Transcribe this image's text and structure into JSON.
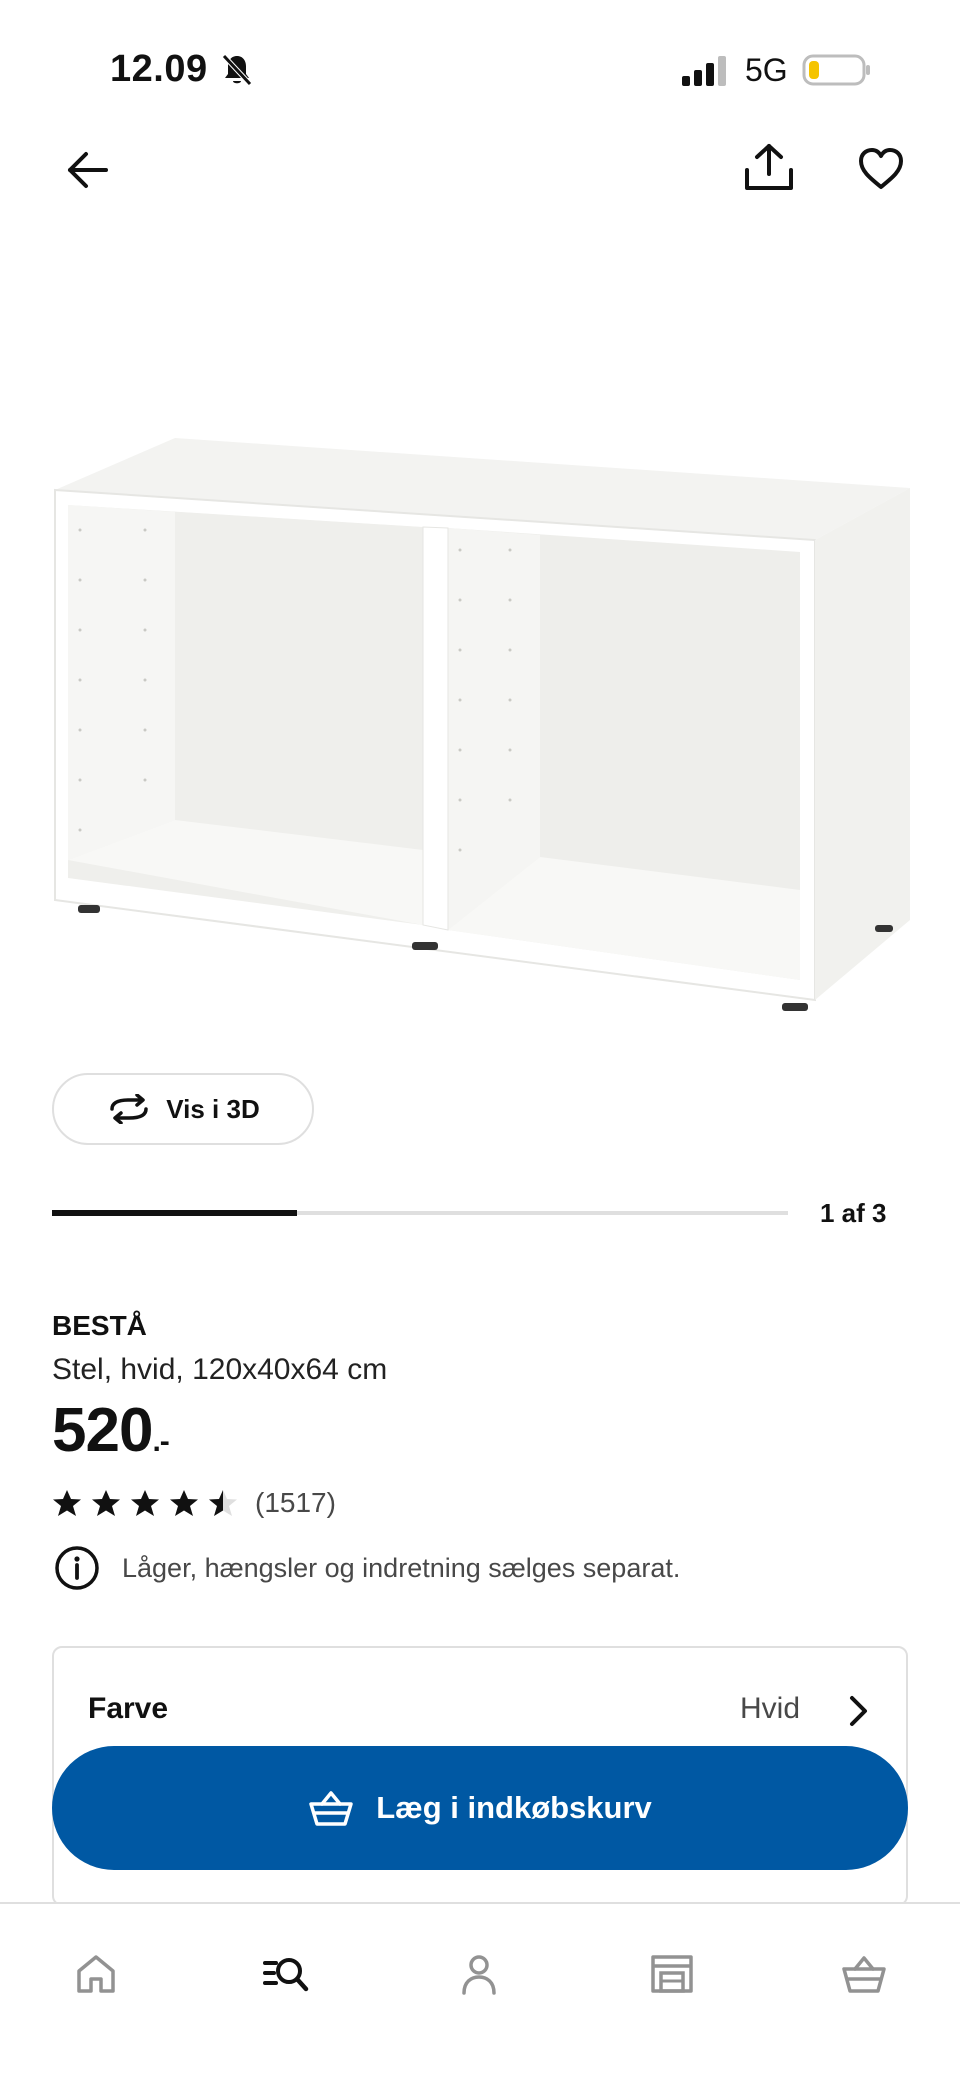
{
  "status_bar": {
    "time": "12.09",
    "network": "5G",
    "battery_color": "#f5c400"
  },
  "nav": {
    "back_icon": "arrow-left-icon",
    "share_icon": "share-icon",
    "favorite_icon": "heart-icon"
  },
  "gallery": {
    "view_3d_label": "Vis i 3D",
    "counter": "1 af 3",
    "current_image": 1,
    "total_images": 3
  },
  "product": {
    "name": "BESTÅ",
    "description": "Stel, hvid, 120x40x64 cm",
    "price": "520",
    "price_suffix": ".-",
    "rating": 4.5,
    "review_count": "(1517)",
    "notice": "Låger, hængsler og indretning sælges separat."
  },
  "options": {
    "color_label": "Farve",
    "color_value": "Hvid"
  },
  "cart": {
    "add_label": "Læg i indkøbskurv",
    "button_color": "#0058a3"
  },
  "bottom_nav": {
    "items": [
      {
        "icon": "home-icon"
      },
      {
        "icon": "search-icon"
      },
      {
        "icon": "profile-icon"
      },
      {
        "icon": "store-icon"
      },
      {
        "icon": "basket-icon"
      }
    ]
  }
}
